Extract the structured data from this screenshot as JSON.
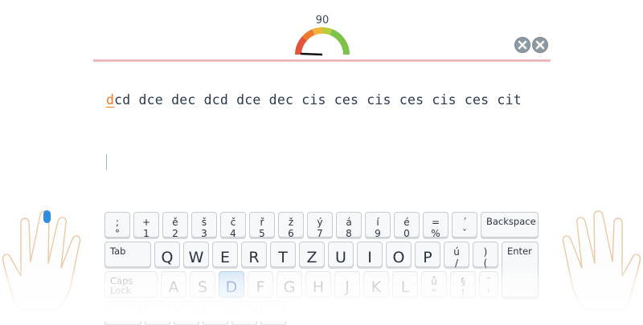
{
  "speed": {
    "value": "90",
    "level": 0.9
  },
  "controls": {
    "icons": [
      "close-icon",
      "close-icon"
    ]
  },
  "exercise": {
    "current": "d",
    "rest": "cd dce dec dcd dce dec cis ces cis ces cis ces cit"
  },
  "keyboard": {
    "row1": [
      {
        "top": ";",
        "bot": "°"
      },
      {
        "top": "+",
        "bot": "1"
      },
      {
        "top": "ě",
        "bot": "2"
      },
      {
        "top": "š",
        "bot": "3"
      },
      {
        "top": "č",
        "bot": "4"
      },
      {
        "top": "ř",
        "bot": "5"
      },
      {
        "top": "ž",
        "bot": "6"
      },
      {
        "top": "ý",
        "bot": "7"
      },
      {
        "top": "á",
        "bot": "8"
      },
      {
        "top": "í",
        "bot": "9"
      },
      {
        "top": "é",
        "bot": "0"
      },
      {
        "top": "=",
        "bot": "%"
      },
      {
        "top": "´",
        "bot": "ˇ"
      }
    ],
    "backspace": "Backspace",
    "tab": "Tab",
    "row2": [
      "Q",
      "W",
      "E",
      "R",
      "T",
      "Z",
      "U",
      "I",
      "O",
      "P"
    ],
    "row2_extra": [
      {
        "top": "ú",
        "bot": "/"
      },
      {
        "top": ")",
        "bot": "("
      }
    ],
    "enter": "Enter",
    "caps": "Caps\nLock",
    "row3": [
      "A",
      "S",
      "D",
      "F",
      "G",
      "H",
      "J",
      "K",
      "L"
    ],
    "row3_extra": [
      {
        "top": "ů",
        "bot": "\""
      },
      {
        "top": "§",
        "bot": "!"
      },
      {
        "top": "¨",
        "bot": "'"
      }
    ],
    "active_key": "D"
  },
  "colors": {
    "accent": "#f07a25",
    "active_key": "#cde2f6",
    "progress": "#f0b7bc"
  }
}
